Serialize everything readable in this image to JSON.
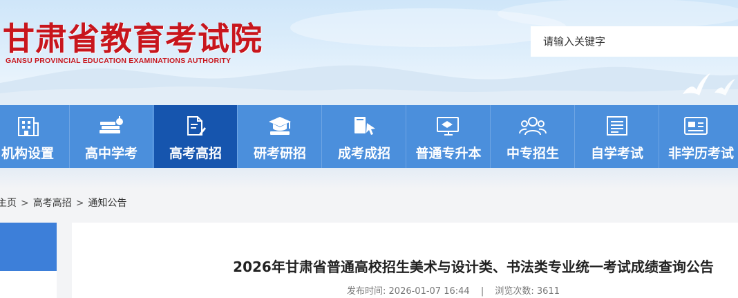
{
  "header": {
    "title": "甘肃省教育考试院",
    "subtitle": "GANSU PROVINCIAL EDUCATION EXAMINATIONS AUTHORITY",
    "search_placeholder": "请输入关键字"
  },
  "nav": {
    "items": [
      {
        "label": "机构设置",
        "icon": "building-icon"
      },
      {
        "label": "高中学考",
        "icon": "books-apple-icon"
      },
      {
        "label": "高考高招",
        "icon": "document-pen-icon",
        "active": true
      },
      {
        "label": "研考研招",
        "icon": "graduation-cap-icon"
      },
      {
        "label": "成考成招",
        "icon": "book-cursor-icon"
      },
      {
        "label": "普通专升本",
        "icon": "monitor-icon"
      },
      {
        "label": "中专招生",
        "icon": "users-icon"
      },
      {
        "label": "自学考试",
        "icon": "notebook-icon"
      },
      {
        "label": "非学历考试",
        "icon": "id-card-icon"
      }
    ]
  },
  "breadcrumb": {
    "home": "主页",
    "section": "高考高招",
    "current": "通知公告",
    "separator": ">"
  },
  "article": {
    "title": "2026年甘肃省普通高校招生美术与设计类、书法类专业统一考试成绩查询公告",
    "publish_label": "发布时间:",
    "publish_time": "2026-01-07 16:44",
    "views_label": "浏览次数:",
    "views": "3611",
    "meta_separator": "|"
  },
  "colors": {
    "brand_red": "#c8161d",
    "nav_blue": "#4b8fdc",
    "nav_active": "#1655ae"
  }
}
